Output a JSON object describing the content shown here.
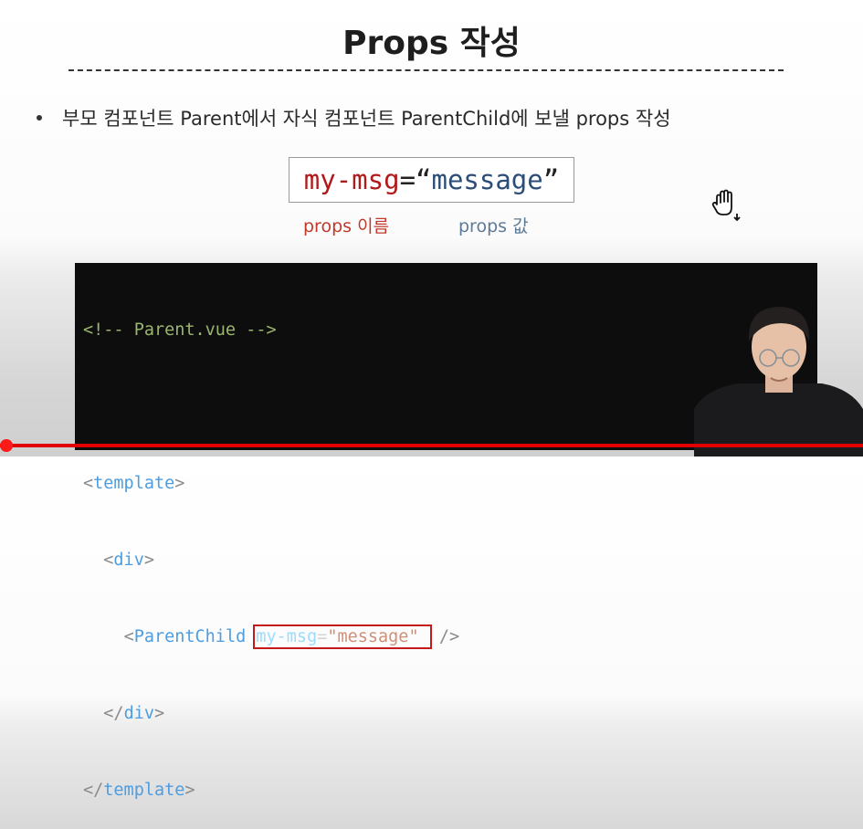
{
  "slide": {
    "title": "Props 작성",
    "bullet": "부모 컴포넌트 Parent에서 자식 컴포넌트 ParentChild에 보낼 props 작성",
    "syntax": {
      "name": "my-msg",
      "equals": "=",
      "open_quote": "“",
      "value": "message",
      "close_quote": "”"
    },
    "label_name": "props 이름",
    "label_value": "props 값"
  },
  "code": {
    "comment": "<!-- Parent.vue -->",
    "lines": {
      "template_open_tag": "template",
      "div_open_tag": "div",
      "child_tag": "ParentChild",
      "attr_name": "my-msg",
      "attr_eq": "=",
      "attr_value": "\"message\"",
      "self_close": "/>",
      "div_close_tag": "div",
      "template_close_tag": "template"
    }
  },
  "colors": {
    "props_name": "#c0392b",
    "props_value": "#5d7a96",
    "highlight": "#c41a1a",
    "progress": "#e00000"
  },
  "icons": {
    "cursor": "hand-grab-cursor-icon"
  }
}
